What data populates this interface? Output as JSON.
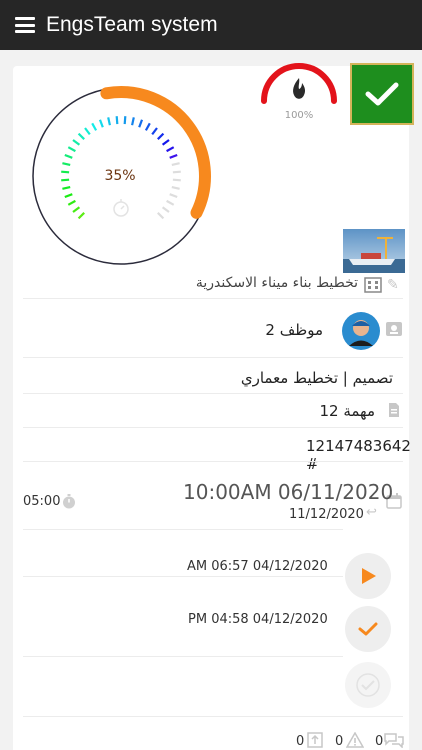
{
  "app": {
    "title": "EngsTeam system"
  },
  "project": {
    "progress_label": "35%",
    "progress": 0.35,
    "priority_label": "100%",
    "name": "تخطيط بناء ميناء الاسكندرية",
    "employee": "موظف 2",
    "category": "تصميم | تخطيط معماري",
    "task": "مهمة 12",
    "id": "12147483642",
    "id_prefix": "#",
    "start_datetime": "10:00AM 06/11/2020",
    "end_date": "11/12/2020",
    "duration": "05:00",
    "started_at": "AM 06:57 04/12/2020",
    "finished_at": "PM 04:58 04/12/2020"
  },
  "counters": {
    "uploads": "0",
    "warnings": "0",
    "comments": "0"
  },
  "colors": {
    "accent": "#f7891e",
    "done": "#1e8e1e",
    "priority": "#e3131b"
  },
  "icons": [
    "menu-icon",
    "check-icon",
    "flame-icon",
    "stopwatch-icon",
    "pencil-icon",
    "building-icon",
    "user-card-icon",
    "document-icon",
    "calendar-icon",
    "reply-icon",
    "timer-icon",
    "play-icon",
    "upload-icon",
    "warning-icon",
    "comments-icon"
  ]
}
